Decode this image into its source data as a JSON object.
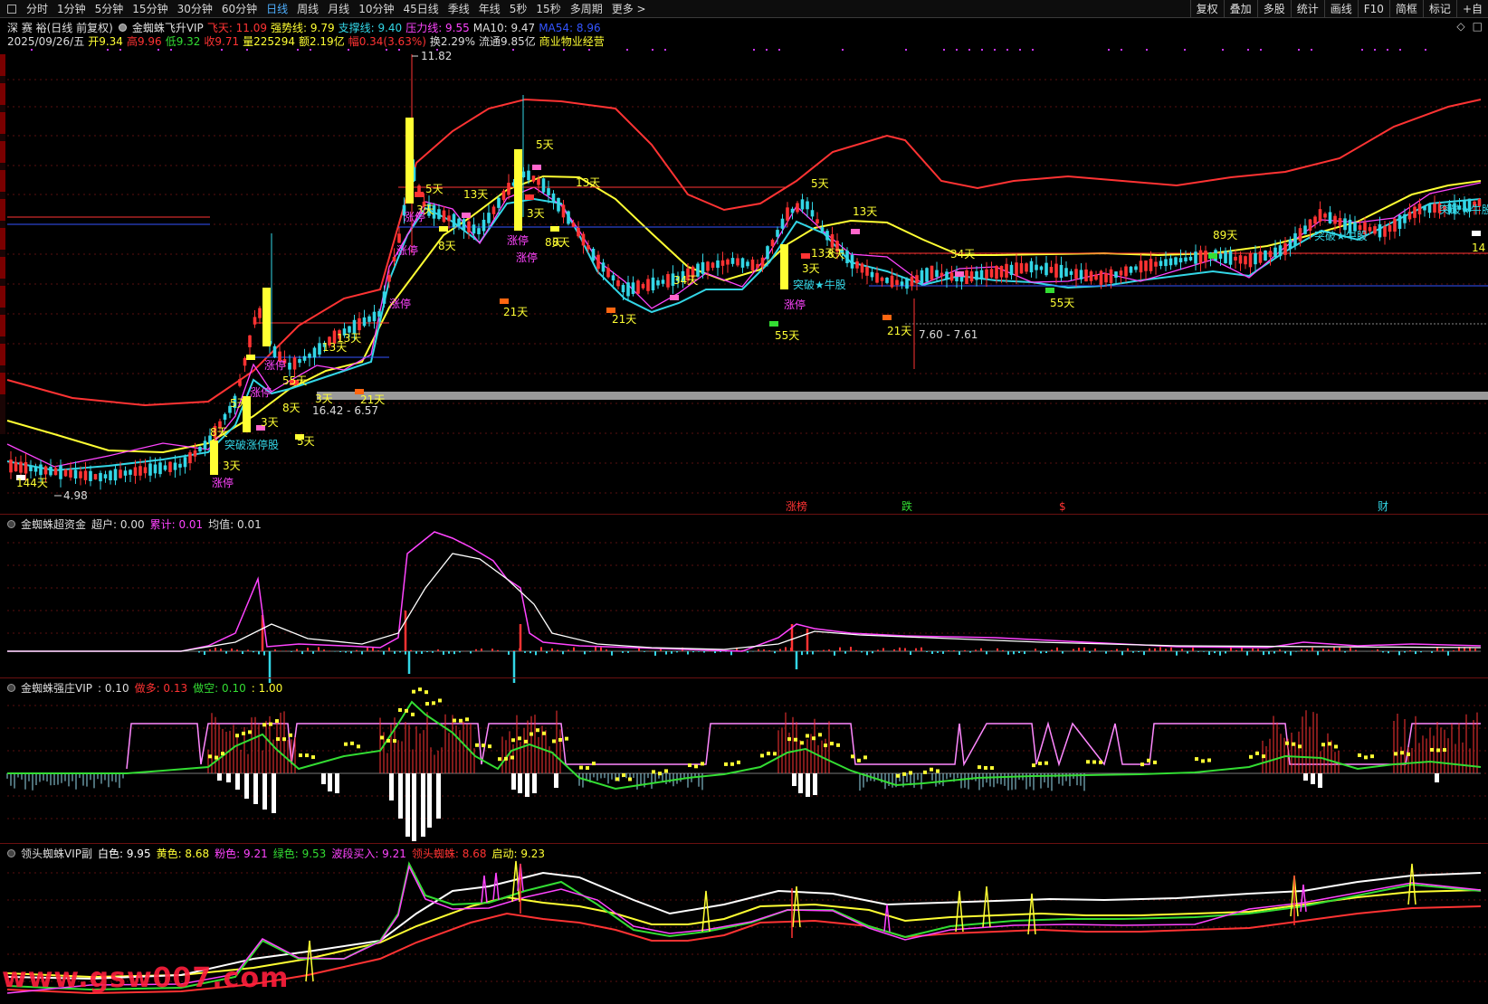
{
  "toolbar": {
    "items": [
      "分时",
      "1分钟",
      "5分钟",
      "15分钟",
      "30分钟",
      "60分钟",
      "日线",
      "周线",
      "月线",
      "10分钟",
      "45日线",
      "季线",
      "年线",
      "5秒",
      "15秒",
      "多周期",
      "更多 >"
    ],
    "active": "日线",
    "right": [
      "复权",
      "叠加",
      "多股",
      "统计",
      "画线",
      "F10",
      "简框",
      "标记",
      "+自"
    ]
  },
  "header": {
    "stock": "深 赛 裕(日线 前复权)",
    "indicator": "金蜘蛛飞升VIP",
    "fly_label": "飞天: 11.09",
    "strong_label": "强势线: 9.79",
    "support_label": "支撑线: 9.40",
    "pressure_label": "压力线: 9.55",
    "ma10_label": "MA10: 9.47",
    "ma54_label": "MA54: 8.96",
    "date": "2025/09/26/五",
    "open": "开9.34",
    "high": "高9.96",
    "low": "低9.32",
    "close": "收9.71",
    "volume": "量225294",
    "amount": "额2.19亿",
    "change": "幅0.34(3.63%)",
    "turnover": "换2.29%",
    "float": "流通9.85亿",
    "sector": "商业物业经营"
  },
  "colors": {
    "up": "#ff3333",
    "down": "#33d6e6",
    "yellow": "#ffff33",
    "magenta": "#ff44ff",
    "green": "#33dd33",
    "white": "#ffffff",
    "blue": "#3355ff",
    "pink": "#ff66cc"
  },
  "main_chart": {
    "price_labels": [
      "11.82",
      "4.98",
      "16.42 - 6.57",
      "7.60 - 7.61",
      "14"
    ],
    "day_labels": [
      "144天",
      "3天",
      "5天",
      "3天",
      "8天",
      "5天",
      "13天",
      "21天",
      "3天",
      "5天",
      "13天",
      "8天",
      "5天",
      "3天",
      "13天",
      "8天",
      "21天",
      "34天",
      "21天",
      "55天",
      "5天",
      "3天",
      "13天",
      "8天",
      "21天",
      "34天",
      "55天",
      "89天",
      "13天",
      "55天",
      "3天",
      "8天",
      "8天",
      "13天"
    ],
    "tags": [
      "涨停",
      "突破涨停股",
      "涨停",
      "涨停",
      "涨停",
      "涨停",
      "涨停",
      "涨停",
      "涨停",
      "突破★牛股",
      "涨停",
      "突破★牛股",
      "突破★牛股"
    ],
    "event_markers": [
      "涨榜",
      "跌",
      "$",
      "财"
    ]
  },
  "panel2": {
    "title": "金蜘蛛超资金",
    "super_label": "超户: 0.00",
    "cum_label": "累计: 0.01",
    "avg_label": "均值: 0.01"
  },
  "panel3": {
    "title": "金蜘蛛强庄VIP",
    "value": ": 0.10",
    "long_label": "做多: 0.13",
    "short_label": "做空: 0.10",
    "extra": ": 1.00"
  },
  "panel4": {
    "title": "领头蜘蛛VIP副",
    "white_label": "白色: 9.95",
    "yellow_label": "黄色: 8.68",
    "pink_label": "粉色: 9.21",
    "green_label": "绿色: 9.53",
    "wave_label": "波段买入: 9.21",
    "lead_label": "领头蜘蛛: 8.68",
    "start_label": "启动: 9.23"
  },
  "watermark": "www.gsw007.com"
}
